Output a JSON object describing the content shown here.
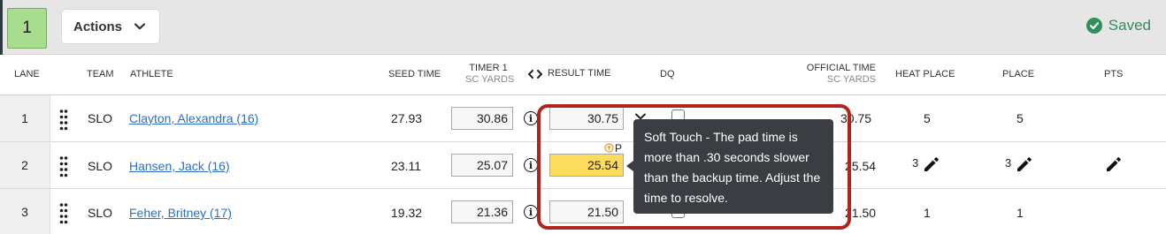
{
  "heat": {
    "number": "1"
  },
  "toolbar": {
    "actions_label": "Actions",
    "status_label": "Saved"
  },
  "columns": {
    "lane": "LANE",
    "team": "TEAM",
    "athlete": "ATHLETE",
    "seed_time": "SEED TIME",
    "timer1": "TIMER 1",
    "timer1_sub": "SC YARDS",
    "result_time": "RESULT TIME",
    "dq": "DQ",
    "official_time": "OFFICIAL TIME",
    "official_time_sub": "SC YARDS",
    "heat_place": "HEAT PLACE",
    "place": "PLACE",
    "pts": "PTS"
  },
  "rows": [
    {
      "lane": "1",
      "team": "SLO",
      "athlete": "Clayton, Alexandra (16)",
      "seed_time": "27.93",
      "timer1": "30.86",
      "result_time": "30.75",
      "official_time": "30.75",
      "heat_place": "5",
      "place": "5"
    },
    {
      "lane": "2",
      "team": "SLO",
      "athlete": "Hansen, Jack (16)",
      "seed_time": "23.11",
      "timer1": "25.07",
      "result_time": "25.54",
      "result_flag": "P",
      "official_time": "25.54",
      "heat_place": "3",
      "place": "3"
    },
    {
      "lane": "3",
      "team": "SLO",
      "athlete": "Feher, Britney (17)",
      "seed_time": "19.32",
      "timer1": "21.36",
      "result_time": "21.50",
      "official_time": "21.50",
      "heat_place": "1",
      "place": "1"
    }
  ],
  "tooltip": {
    "text": "Soft Touch - The pad time is more than .30 seconds slower than the backup time. Adjust the time to resolve."
  },
  "colors": {
    "warning_fill": "#fddc5c",
    "highlight_border": "#b1241c",
    "saved_green": "#2f8e5a",
    "heat_badge": "#a8dc8e"
  }
}
